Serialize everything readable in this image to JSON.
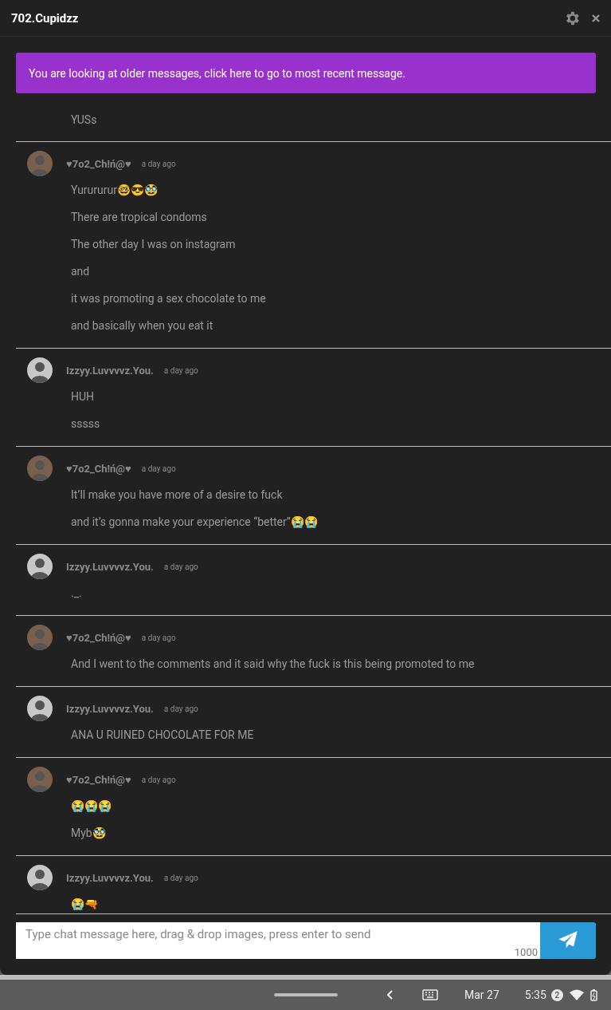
{
  "window": {
    "title": "702.Cupidzz"
  },
  "banner": {
    "text": "You are looking at older messages, click here to go to most recent message."
  },
  "groups": [
    {
      "lines": [
        "YUSs"
      ]
    },
    {
      "author": "♥7o2_Ch!ń@♥",
      "time": "a day ago",
      "color": "#7a5f4c",
      "lines": [
        "Yurururur🤓😎🥸",
        "There are tropical condoms",
        "The other day I was on instagram",
        "and",
        "it was promoting a sex chocolate to me",
        "and basically when you eat it"
      ]
    },
    {
      "author": "Izzyy.Luvvvvz.You.",
      "time": "a day ago",
      "color": "#c8c8c8",
      "lines": [
        "HUH",
        "sssss"
      ]
    },
    {
      "author": "♥7o2_Ch!ń@♥",
      "time": "a day ago",
      "color": "#7a5f4c",
      "lines": [
        "It’ll make you have more of a desire to fuck",
        "and it’s gonna make your experience “better”😭😭"
      ]
    },
    {
      "author": "Izzyy.Luvvvvz.You.",
      "time": "a day ago",
      "color": "#c8c8c8",
      "lines": [
        "._."
      ]
    },
    {
      "author": "♥7o2_Ch!ń@♥",
      "time": "a day ago",
      "color": "#7a5f4c",
      "lines": [
        "And I went to the comments and it said why the fuck is this being promoted to me"
      ]
    },
    {
      "author": "Izzyy.Luvvvvz.You.",
      "time": "a day ago",
      "color": "#c8c8c8",
      "lines": [
        "ANA U RUINED CHOCOLATE FOR ME"
      ]
    },
    {
      "author": "♥7o2_Ch!ń@♥",
      "time": "a day ago",
      "color": "#7a5f4c",
      "lines": [
        "😭😭😭",
        "Myb🥸"
      ]
    },
    {
      "author": "Izzyy.Luvvvvz.You.",
      "time": "a day ago",
      "color": "#c8c8c8",
      "lines": [
        "😭🔫"
      ]
    }
  ],
  "composer": {
    "placeholder": "Type chat message here, drag & drop images, press enter to send",
    "counter": "1000"
  },
  "taskbar": {
    "date": "Mar 27",
    "time": "5:35",
    "notifications": "2"
  }
}
